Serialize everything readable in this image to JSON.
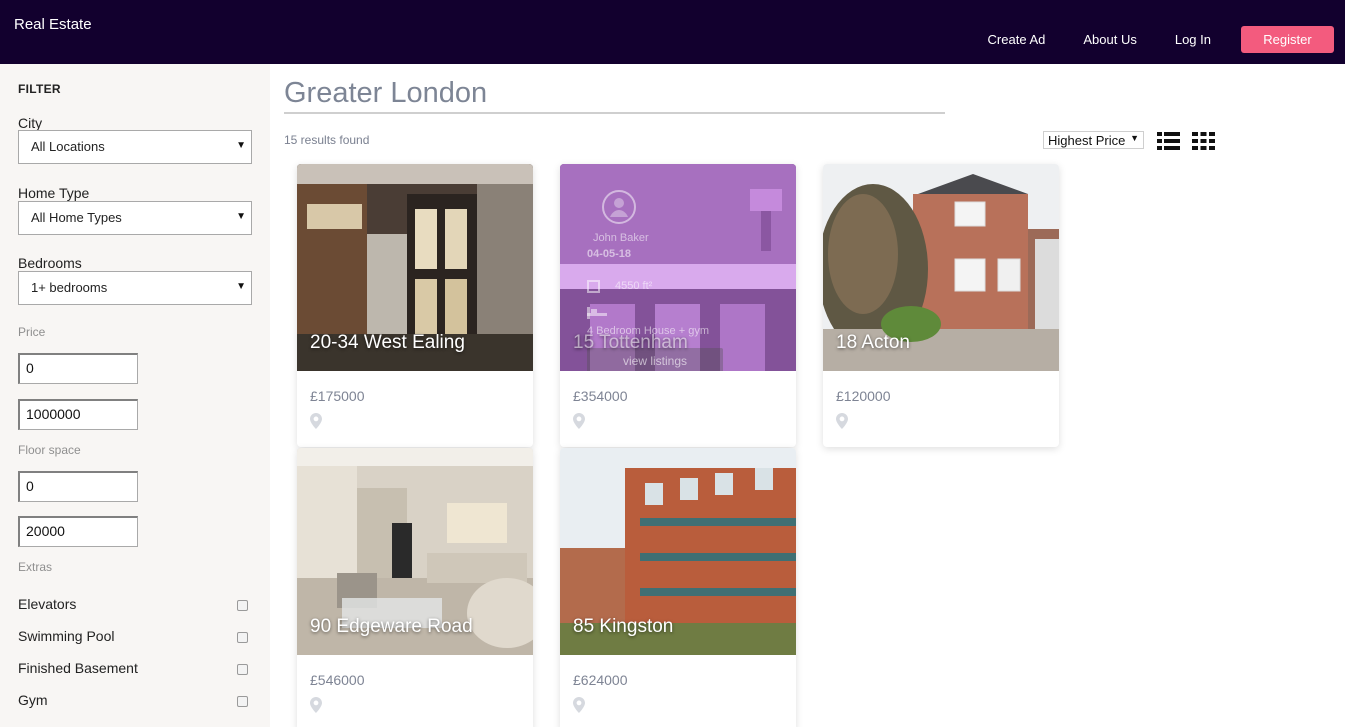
{
  "header": {
    "brand": "Real Estate",
    "nav": [
      "Create Ad",
      "About Us",
      "Log In"
    ],
    "register": "Register",
    "colors": {
      "bar": "#12002e",
      "register": "#f35b7e"
    }
  },
  "filter": {
    "title": "FILTER",
    "city": {
      "label": "City",
      "value": "All Locations"
    },
    "home_type": {
      "label": "Home Type",
      "value": "All Home Types"
    },
    "bedrooms": {
      "label": "Bedrooms",
      "value": "1+ bedrooms"
    },
    "price": {
      "label": "Price",
      "min": "0",
      "max": "1000000"
    },
    "floor_space": {
      "label": "Floor space",
      "min": "0",
      "max": "20000"
    },
    "extras": {
      "label": "Extras",
      "items": [
        "Elevators",
        "Swimming Pool",
        "Finished Basement",
        "Gym"
      ]
    }
  },
  "main": {
    "title": "Greater London",
    "results": "15 results found",
    "sort": "Highest Price",
    "listings": [
      {
        "name": "20-34 West Ealing",
        "price": "£175000"
      },
      {
        "name": "15 Tottenham",
        "price": "£354000",
        "hover": {
          "agent": "John Baker",
          "date": "04-05-18",
          "area": "4550 ft²",
          "description": "4 Bedroom House + gym",
          "button": "view listings"
        }
      },
      {
        "name": "18 Acton",
        "price": "£120000"
      },
      {
        "name": "90 Edgeware Road",
        "price": "£546000"
      },
      {
        "name": "85 Kingston",
        "price": "£624000"
      }
    ]
  }
}
